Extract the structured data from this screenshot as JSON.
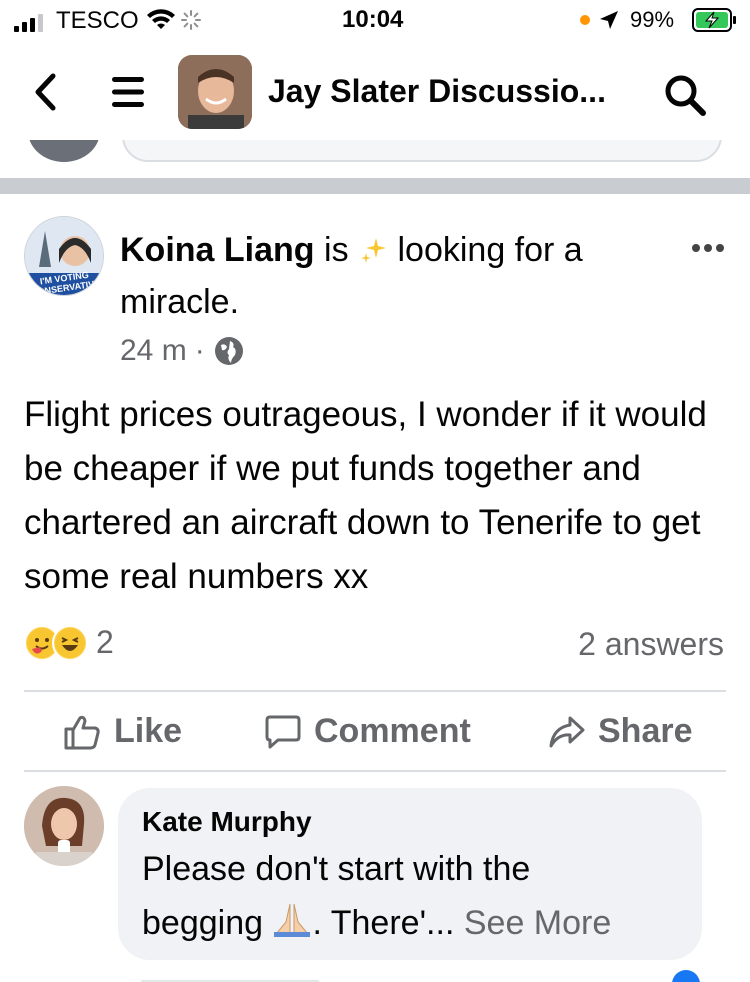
{
  "status_bar": {
    "carrier": "TESCO",
    "time": "10:04",
    "battery_percent": "99%"
  },
  "nav": {
    "title": "Jay Slater Discussio..."
  },
  "post": {
    "author": "Koina Liang",
    "activity_prefix": "is",
    "activity": "looking for a miracle.",
    "time": "24 m",
    "separator": "·",
    "body": "Flight prices outrageous, I wonder if it would be cheaper if we put funds together and chartered an aircraft down to Tenerife to get some real numbers xx",
    "reaction_count": "2",
    "answers": "2 answers",
    "avatar_badge": "I'M VOTING CONSERVATIVE"
  },
  "actions": {
    "like": "Like",
    "comment": "Comment",
    "share": "Share"
  },
  "comment": {
    "author": "Kate Murphy",
    "text_line1": "Please don't start with the",
    "text_line2_start": "begging",
    "text_line2_end": ". There'...",
    "see_more": "See More"
  },
  "colors": {
    "secondary_text": "#65676b",
    "divider": "#c9ccd1",
    "bubble": "#f0f2f5"
  }
}
